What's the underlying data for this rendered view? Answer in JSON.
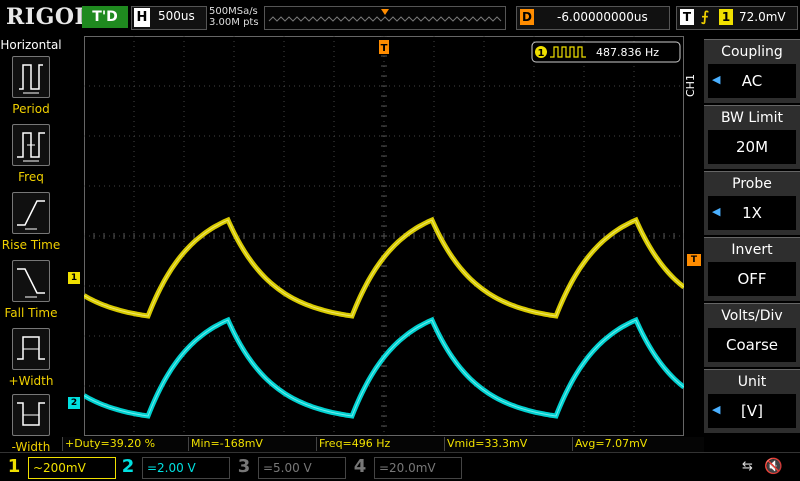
{
  "top": {
    "logo": "RIGOL",
    "trigger_status": "T'D",
    "horizontal_key": "H",
    "timebase": "500us",
    "sample_rate": "500MSa/s",
    "memory_depth": "3.00M pts",
    "delay_key": "D",
    "delay": "-6.00000000us",
    "trigger_key": "T",
    "trigger_source": "1",
    "trigger_level": "72.0mV"
  },
  "left_panel": {
    "title": "Horizontal",
    "items": [
      {
        "label": "Period",
        "icon": "period-icon"
      },
      {
        "label": "Freq",
        "icon": "frequency-icon"
      },
      {
        "label": "Rise Time",
        "icon": "rise-time-icon"
      },
      {
        "label": "Fall Time",
        "icon": "fall-time-icon"
      },
      {
        "label": "+Width",
        "icon": "positive-width-icon"
      },
      {
        "label": "-Width",
        "icon": "negative-width-icon"
      }
    ]
  },
  "frequency_counter": {
    "channel": "1",
    "value": "487.836 Hz"
  },
  "markers": {
    "trigger_top": "T",
    "trigger_right": "T",
    "ch1": "1",
    "ch2": "2"
  },
  "right_menu": {
    "channel_tag": "CH1",
    "items": [
      {
        "title": "Coupling",
        "value": "AC",
        "arrow": true
      },
      {
        "title": "BW Limit",
        "value": "20M",
        "arrow": false
      },
      {
        "title": "Probe",
        "value": "1X",
        "arrow": true
      },
      {
        "title": "Invert",
        "value": "OFF",
        "arrow": false
      },
      {
        "title": "Volts/Div",
        "value": "Coarse",
        "arrow": false
      },
      {
        "title": "Unit",
        "value": "[V]",
        "arrow": true
      }
    ]
  },
  "measurements": [
    {
      "text": "+Duty=39.20 %"
    },
    {
      "text": "Min=-168mV"
    },
    {
      "text": "Freq=496 Hz"
    },
    {
      "text": "Vmid=33.3mV"
    },
    {
      "text": "Avg=7.07mV"
    }
  ],
  "channels": [
    {
      "num": "1",
      "coupling": "~",
      "scale": "200mV",
      "color": "#f0e000",
      "active": true
    },
    {
      "num": "2",
      "coupling": "=",
      "scale": "2.00 V",
      "color": "#00e0e0",
      "active": true
    },
    {
      "num": "3",
      "coupling": "=",
      "scale": "5.00 V",
      "color": "#777777",
      "active": false
    },
    {
      "num": "4",
      "coupling": "=",
      "scale": "20.0mV",
      "color": "#777777",
      "active": false
    }
  ],
  "colors": {
    "ch1": "#f0e000",
    "ch2": "#00e8e8",
    "accent": "#4ab0ff",
    "trigger": "#ff8c00"
  }
}
